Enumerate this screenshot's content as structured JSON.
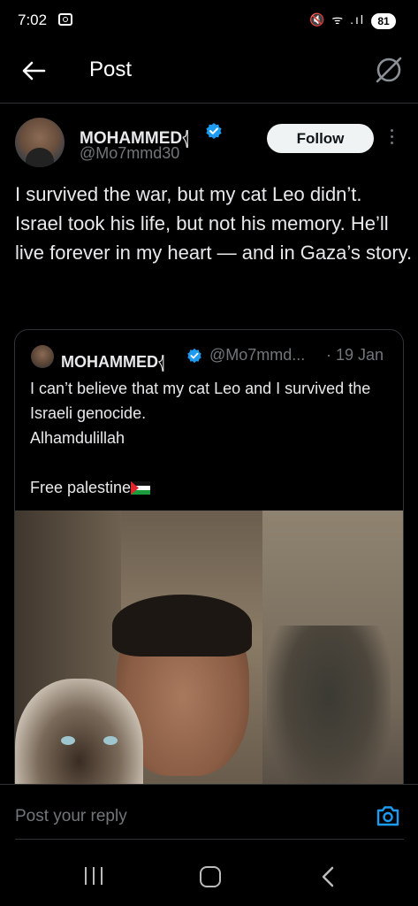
{
  "status_bar": {
    "time": "7:02",
    "signal_icons": "🔇 ᯤ .ıl",
    "battery": "81"
  },
  "header": {
    "title": "Post",
    "back_icon": "arrow-left-icon",
    "grok_icon": "grok-icon"
  },
  "post": {
    "author_name": "MOHAMMED𓂆",
    "author_handle": "@Mo7mmd30",
    "follow_label": "Follow",
    "text_lines": [
      "I survived the war, but my cat Leo didn’t.",
      "Israel took his life, but not his memory. He’ll live forever in my heart — and in Gaza’s story."
    ]
  },
  "quote": {
    "author_name": "MOHAMMED𓂆",
    "author_handle": "@Mo7mmd...",
    "date": "· 19 Jan",
    "text_lines": [
      "I can’t believe that my cat Leo and I survived the Israeli genocide.",
      "Alhamdulillah",
      "",
      "Free palestine"
    ],
    "flag_icon": "palestine-flag-icon"
  },
  "reply": {
    "placeholder": "Post your reply"
  },
  "colors": {
    "background": "#000000",
    "text": "#e7e9ea",
    "secondary_text": "#71767b",
    "divider": "#2f3336",
    "verified_blue": "#1d9bf0"
  }
}
